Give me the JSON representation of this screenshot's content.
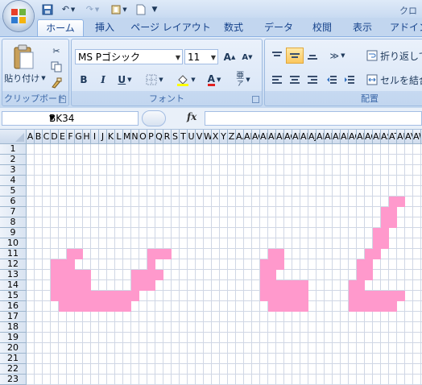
{
  "title": "クロ",
  "tabs": [
    {
      "label": "ホーム",
      "active": true
    },
    {
      "label": "挿入"
    },
    {
      "label": "ページ レイアウト"
    },
    {
      "label": "数式"
    },
    {
      "label": "データ"
    },
    {
      "label": "校閲"
    },
    {
      "label": "表示"
    },
    {
      "label": "アドイン"
    }
  ],
  "ribbon": {
    "clipboard": {
      "label": "クリップボード",
      "paste_label": "貼り付け"
    },
    "font": {
      "label": "フォント",
      "font_name": "MS Pゴシック",
      "font_size": "11",
      "bold": "B",
      "italic": "I",
      "underline": "U"
    },
    "alignment": {
      "label": "配置",
      "wrap_text": "折り返して",
      "merge_center": "セルを結合"
    }
  },
  "formula_bar": {
    "name_box": "BK34",
    "fx": "fx",
    "value": ""
  },
  "columns": [
    "A",
    "B",
    "C",
    "D",
    "E",
    "F",
    "G",
    "H",
    "I",
    "J",
    "K",
    "L",
    "M",
    "N",
    "O",
    "P",
    "Q",
    "R",
    "S",
    "T",
    "U",
    "V",
    "W",
    "X",
    "Y",
    "Z",
    "AA",
    "AB",
    "AC",
    "AD",
    "AE",
    "AF",
    "AG",
    "AH",
    "AI",
    "AJ",
    "AK",
    "AL",
    "AM",
    "AN",
    "AO",
    "AP",
    "AQ",
    "AR",
    "AS",
    "AT",
    "AU",
    "AV",
    "AW"
  ],
  "rows": [
    "1",
    "2",
    "3",
    "4",
    "5",
    "6",
    "7",
    "8",
    "9",
    "10",
    "11",
    "12",
    "13",
    "14",
    "15",
    "16",
    "17",
    "18",
    "19",
    "20",
    "21",
    "22",
    "23"
  ],
  "fill_color": "#ff99cc",
  "filled_cells": [
    {
      "row": 11,
      "cols": [
        6,
        7
      ]
    },
    {
      "row": 11,
      "cols": [
        16,
        17,
        18
      ]
    },
    {
      "row": 11,
      "cols": [
        31,
        32
      ]
    },
    {
      "row": 12,
      "cols": [
        4,
        5,
        6
      ]
    },
    {
      "row": 12,
      "cols": [
        16
      ]
    },
    {
      "row": 12,
      "cols": [
        30,
        31,
        32
      ]
    },
    {
      "row": 13,
      "cols": [
        4,
        5,
        6,
        7,
        8
      ]
    },
    {
      "row": 13,
      "cols": [
        14,
        15,
        16,
        17
      ]
    },
    {
      "row": 13,
      "cols": [
        30,
        31
      ]
    },
    {
      "row": 14,
      "cols": [
        4,
        5,
        6,
        7,
        8
      ]
    },
    {
      "row": 14,
      "cols": [
        14,
        15,
        16
      ]
    },
    {
      "row": 14,
      "cols": [
        30,
        31,
        32,
        33,
        34,
        35
      ]
    },
    {
      "row": 15,
      "cols": [
        4,
        5,
        6,
        7,
        8,
        9,
        10,
        11,
        12,
        13,
        14
      ]
    },
    {
      "row": 15,
      "cols": [
        30,
        31,
        32,
        33,
        34,
        35
      ]
    },
    {
      "row": 16,
      "cols": [
        5,
        6,
        7,
        8,
        9,
        10,
        11,
        12,
        13
      ]
    },
    {
      "row": 16,
      "cols": [
        31,
        32,
        33,
        34,
        35
      ]
    },
    {
      "row": 6,
      "cols": [
        46,
        47
      ]
    },
    {
      "row": 7,
      "cols": [
        45,
        46
      ]
    },
    {
      "row": 8,
      "cols": [
        45,
        46
      ]
    },
    {
      "row": 9,
      "cols": [
        44,
        45
      ]
    },
    {
      "row": 10,
      "cols": [
        44,
        45
      ]
    },
    {
      "row": 11,
      "cols": [
        43,
        44
      ]
    },
    {
      "row": 12,
      "cols": [
        42,
        43
      ]
    },
    {
      "row": 13,
      "cols": [
        42,
        43
      ]
    },
    {
      "row": 14,
      "cols": [
        41,
        42
      ]
    },
    {
      "row": 15,
      "cols": [
        41,
        42,
        43,
        44,
        45,
        46,
        47
      ]
    },
    {
      "row": 16,
      "cols": [
        41,
        42,
        43,
        44,
        45,
        46
      ]
    }
  ]
}
